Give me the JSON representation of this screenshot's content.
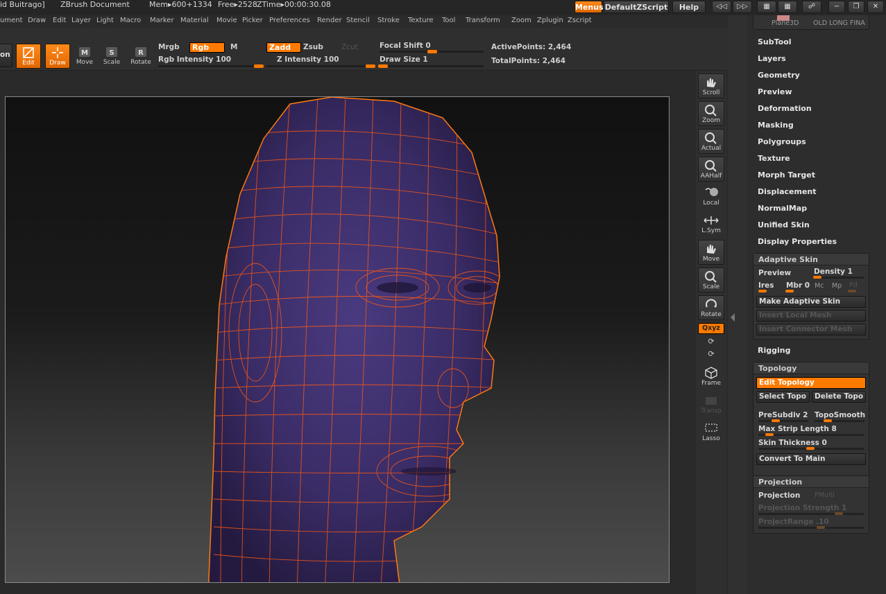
{
  "title_bar": {
    "user": "id Buitrago]",
    "document": "ZBrush Document",
    "mem": "Mem▸600+1334",
    "free": "Free▸2528",
    "ztime": "ZTime▸00:00:30.08",
    "menus_button": "Menus",
    "script_button": "DefaultZScript",
    "help_button": "Help"
  },
  "menu_items": [
    "ument",
    "Draw",
    "Edit",
    "Layer",
    "Light",
    "Macro",
    "Marker",
    "Material",
    "Movie",
    "Picker",
    "Preferences",
    "Render",
    "Stencil",
    "Stroke",
    "Texture",
    "Tool",
    "Transform",
    "Zoom",
    "Zplugin",
    "Zscript"
  ],
  "toolbar": {
    "partial_left": "on",
    "tools": [
      {
        "label": "Edit",
        "active": true
      },
      {
        "label": "Draw",
        "active": true
      },
      {
        "label": "Move",
        "active": false
      },
      {
        "label": "Scale",
        "active": false
      },
      {
        "label": "Rotate",
        "active": false
      }
    ],
    "mrgb": "Mrgb",
    "rgb": "Rgb",
    "m": "M",
    "rgb_intensity": "Rgb  Intensity 100",
    "zadd": "Zadd",
    "zsub": "Zsub",
    "zcut": "Zcut",
    "z_intensity": "Z  Intensity 100",
    "focal_shift": "Focal  Shift 0",
    "draw_size": "Draw  Size 1",
    "active_points": "ActivePoints: 2,464",
    "total_points": "TotalPoints: 2,464"
  },
  "shelf": [
    {
      "label": "Scroll"
    },
    {
      "label": "Zoom"
    },
    {
      "label": "Actual"
    },
    {
      "label": "AAHalf"
    },
    {
      "label": "Local"
    },
    {
      "label": "L.Sym"
    },
    {
      "label": "Move"
    },
    {
      "label": "Scale"
    },
    {
      "label": "Rotate"
    },
    {
      "label": "Qxyz"
    },
    {
      "label": "Frame"
    },
    {
      "label": "Transp"
    },
    {
      "label": "Lasso"
    }
  ],
  "panel": {
    "thumb_label": "Plane3D",
    "thumb_labels_right": "OLD  LONG  FINA",
    "sections": [
      "SubTool",
      "Layers",
      "Geometry",
      "Preview",
      "Deformation",
      "Masking",
      "Polygroups",
      "Texture",
      "Morph Target",
      "Displacement",
      "NormalMap",
      "Unified Skin",
      "Display Properties"
    ],
    "adaptive_skin": {
      "title": "Adaptive Skin",
      "preview": "Preview",
      "density": "Density 1",
      "ires": "Ires",
      "mbr": "Mbr 0",
      "mc": "Mc",
      "mp": "Mp",
      "pd": "Pd",
      "make": "Make Adaptive Skin",
      "insert_local": "Insert Local Mesh",
      "insert_connector": "Insert Connector Mesh"
    },
    "rigging": "Rigging",
    "topology": {
      "title": "Topology",
      "edit": "Edit Topology",
      "select": "Select Topo",
      "delete": "Delete Topo",
      "presubdiv": "PreSubdiv 2",
      "toposmooth": "TopoSmooth",
      "max_strip": "Max  Strip  Length 8",
      "skin_thickness": "Skin  Thickness 0",
      "convert": "Convert To Main"
    },
    "projection": {
      "title": "Projection",
      "projection": "Projection",
      "pmulti": "PMulti",
      "strength": "Projection  Strength 1",
      "range": "ProjectRange .10"
    }
  },
  "colors": {
    "accent": "#ff7a00",
    "background": "#2a2a2a",
    "mesh_surface": "#3d2f6a",
    "wireframe": "#ff5a10"
  }
}
